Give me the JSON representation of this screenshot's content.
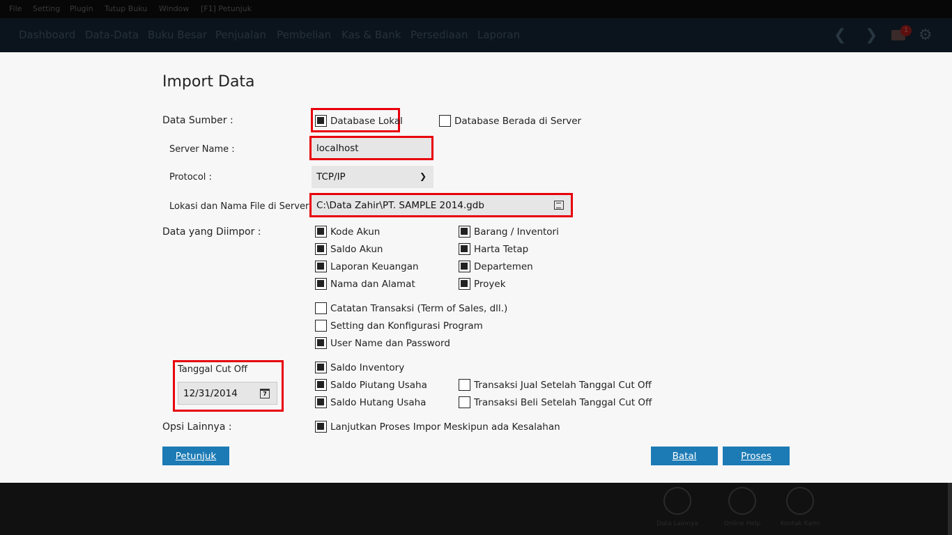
{
  "menu": [
    "File",
    "Setting",
    "Plugin",
    "Tutup Buku",
    "Window",
    "[F1] Petunjuk"
  ],
  "nav": [
    "Dashboard",
    "Data-Data",
    "Buku Besar",
    "Penjualan",
    "Pembelian",
    "Kas & Bank",
    "Persediaan",
    "Laporan"
  ],
  "nav_icons": {
    "back": "chevron-left-icon",
    "forward": "chevron-right-icon",
    "mail": "mail-icon",
    "settings": "gear-icon"
  },
  "mail_badge": "1",
  "title": "Import Data",
  "data_sumber": {
    "label": "Data Sumber  :",
    "lokal_label": "Database Lokal",
    "lokal_checked": true,
    "server_label": "Database Berada di Server",
    "server_checked": false
  },
  "server_name": {
    "label": "Server Name :",
    "value": "localhost"
  },
  "protocol": {
    "label": "Protocol :",
    "value": "TCP/IP"
  },
  "lokasi": {
    "label": "Lokasi dan Nama File di Server :",
    "value": "C:\\Data Zahir\\PT. SAMPLE 2014.gdb"
  },
  "data_diimpor": {
    "label": "Data yang Diimpor :",
    "left": [
      {
        "label": "Kode Akun",
        "checked": true
      },
      {
        "label": "Saldo Akun",
        "checked": true
      },
      {
        "label": "Laporan Keuangan",
        "checked": true
      },
      {
        "label": "Nama dan Alamat",
        "checked": true
      }
    ],
    "right": [
      {
        "label": "Barang / Inventori",
        "checked": true
      },
      {
        "label": "Harta Tetap",
        "checked": true
      },
      {
        "label": "Departemen",
        "checked": true
      },
      {
        "label": "Proyek",
        "checked": true
      }
    ],
    "extra": [
      {
        "label": "Catatan Transaksi (Term of Sales, dll.)",
        "checked": false
      },
      {
        "label": "Setting dan Konfigurasi Program",
        "checked": false
      },
      {
        "label": "User Name dan Password",
        "checked": true
      }
    ]
  },
  "cutoff": {
    "label": "Tanggal Cut Off",
    "date": "12/31/2014",
    "calendar_day": "7",
    "saldo": [
      {
        "label": "Saldo Inventory",
        "checked": true
      },
      {
        "label": "Saldo Piutang Usaha",
        "checked": true
      },
      {
        "label": "Saldo Hutang Usaha",
        "checked": true
      }
    ],
    "transaksi": [
      {
        "label": "Transaksi Jual Setelah Tanggal Cut Off",
        "checked": false
      },
      {
        "label": "Transaksi Beli Setelah Tanggal Cut Off",
        "checked": false
      }
    ]
  },
  "opsi": {
    "label": "Opsi Lainnya :",
    "option_label": "Lanjutkan Proses Impor Meskipun ada Kesalahan",
    "option_checked": true
  },
  "buttons": {
    "petunjuk": "Petunjuk",
    "batal": "Batal",
    "proses": "Proses"
  },
  "colors": {
    "accent": "#1c7bb5",
    "highlight": "#e8000b",
    "background": "#f7f7f7"
  },
  "footer": [
    "Data Lainnya",
    "Online Help",
    "Kontak Kami"
  ]
}
